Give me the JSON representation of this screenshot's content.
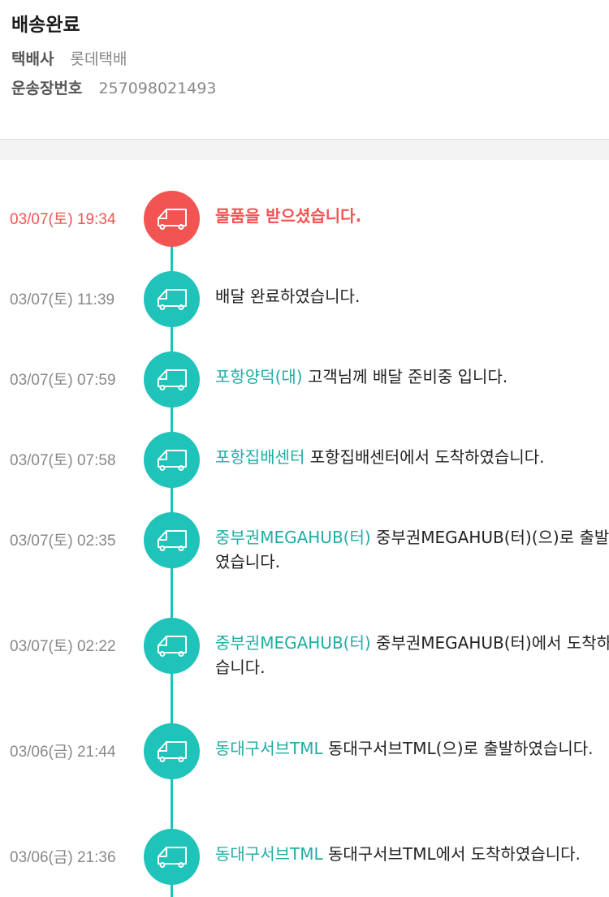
{
  "header": {
    "status": "배송완료",
    "carrier_label": "택배사",
    "carrier_value": "롯데택배",
    "tracking_label": "운송장번호",
    "tracking_value": "257098021493"
  },
  "colors": {
    "accent": "#1fc3b9",
    "highlight": "#f25452",
    "location_text": "#1fada4"
  },
  "events": [
    {
      "time": "03/07(토) 19:34",
      "location": "",
      "message": "물품을 받으셨습니다.",
      "icon": "truck-icon",
      "highlight": true
    },
    {
      "time": "03/07(토) 11:39",
      "location": "",
      "message": "배달 완료하였습니다.",
      "icon": "truck-icon",
      "highlight": false
    },
    {
      "time": "03/07(토) 07:59",
      "location": "포항양덕(대)",
      "message": "고객님께 배달 준비중 입니다.",
      "icon": "truck-icon",
      "highlight": false
    },
    {
      "time": "03/07(토) 07:58",
      "location": "포항집배센터",
      "message": "포항집배센터에서 도착하였습니다.",
      "icon": "truck-icon",
      "highlight": false
    },
    {
      "time": "03/07(토) 02:35",
      "location": "중부권MEGAHUB(터)",
      "message": "중부권MEGAHUB(터)(으)로 출발하였습니다.",
      "icon": "truck-icon",
      "highlight": false
    },
    {
      "time": "03/07(토) 02:22",
      "location": "중부권MEGAHUB(터)",
      "message": "중부권MEGAHUB(터)에서 도착하였습니다.",
      "icon": "truck-icon",
      "highlight": false
    },
    {
      "time": "03/06(금) 21:44",
      "location": "동대구서브TML",
      "message": "동대구서브TML(으)로 출발하였습니다.",
      "icon": "truck-icon",
      "highlight": false
    },
    {
      "time": "03/06(금) 21:36",
      "location": "동대구서브TML",
      "message": "동대구서브TML에서 도착하였습니다.",
      "icon": "truck-icon",
      "highlight": false
    }
  ]
}
